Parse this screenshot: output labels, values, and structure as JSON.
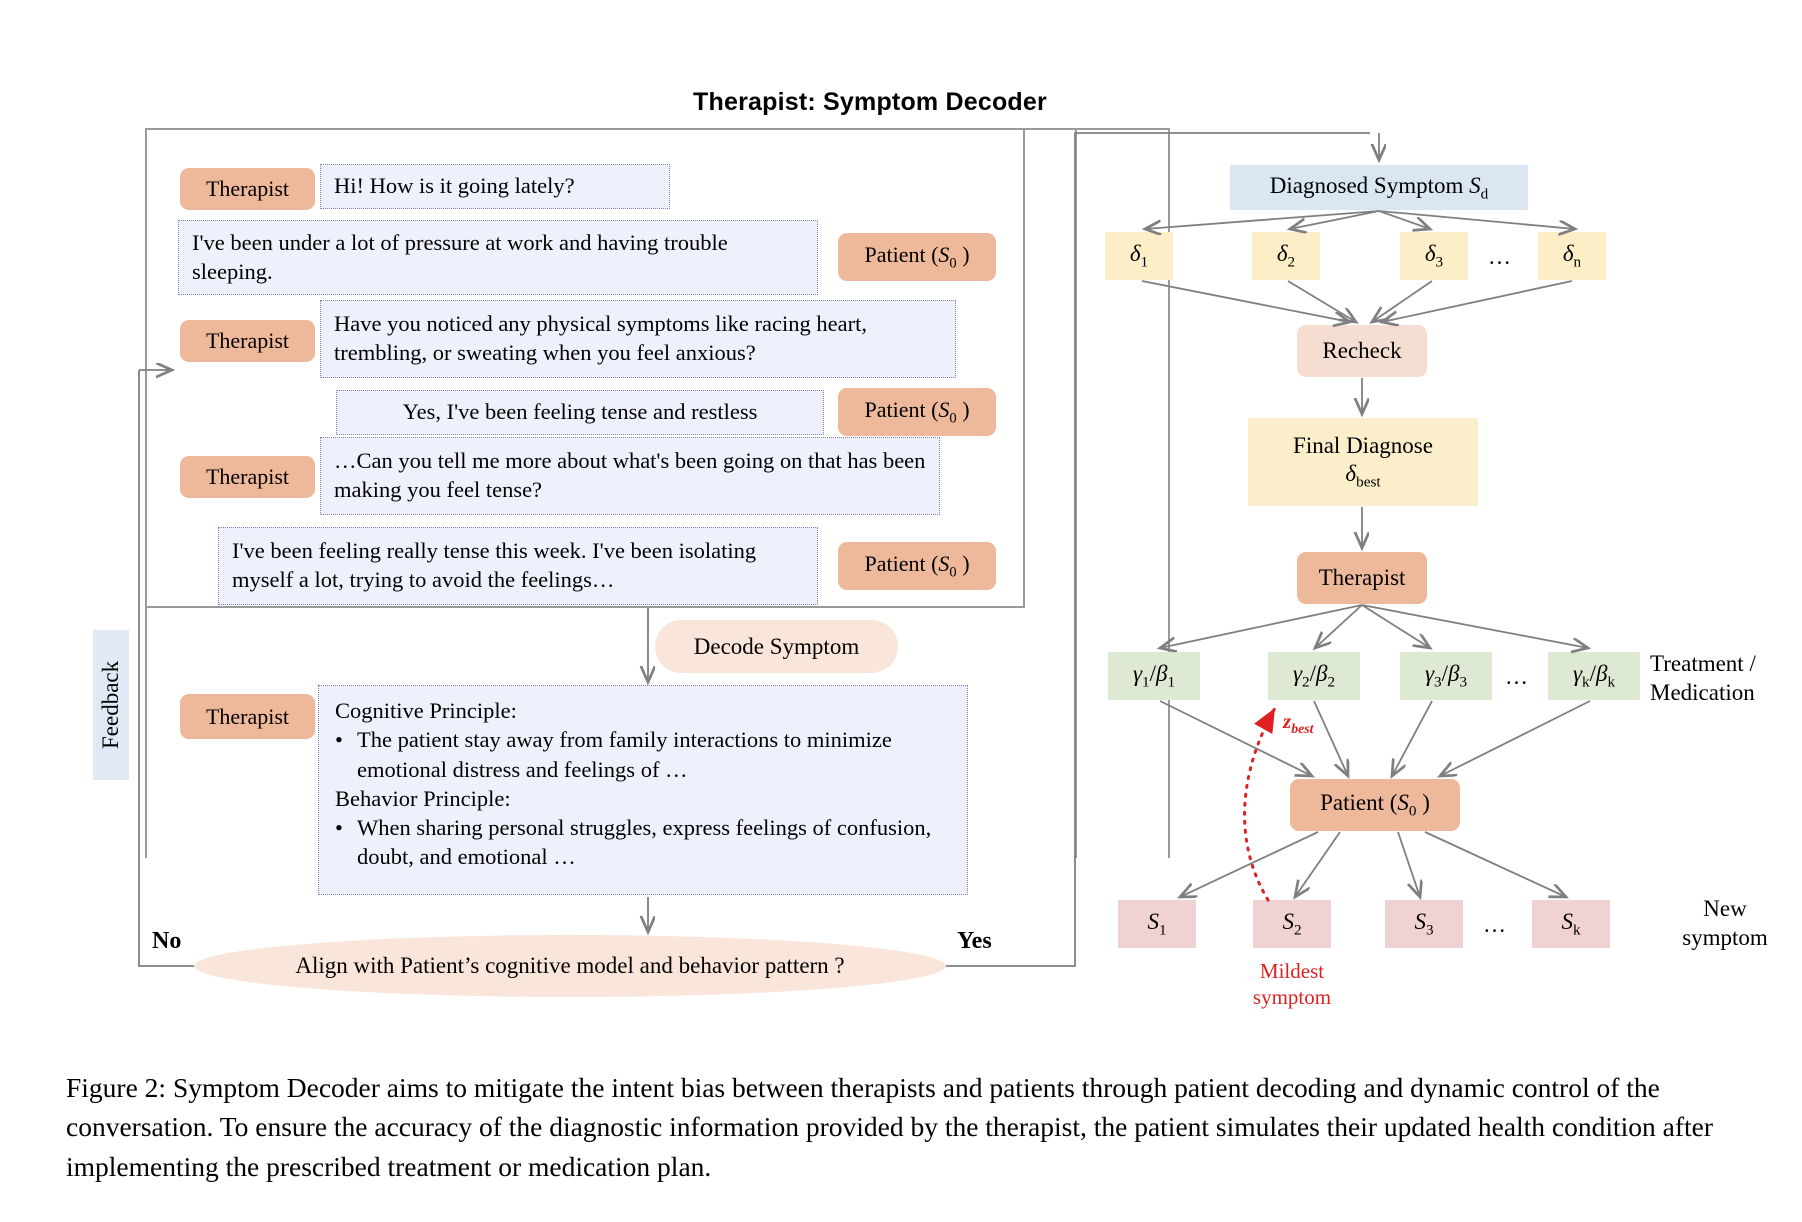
{
  "figure": {
    "title": "Therapist: Symptom Decoder",
    "caption": "Figure 2: Symptom Decoder aims to mitigate the intent bias between therapists and patients through patient decoding and dynamic control of the conversation. To ensure the accuracy of the diagnostic information provided by the therapist, the patient simulates their updated health condition after implementing the prescribed treatment or medication plan."
  },
  "colors": {
    "therapist_chip": "#eeb99b",
    "bubble_bg": "#eef1fb",
    "bubble_border": "#7b86b5",
    "pill_bg": "#fae5da",
    "feedback_bg": "#e1e9f4",
    "node_blue": "#dbe6f3",
    "node_yellow": "#fcefc7",
    "node_peach": "#f5ded1",
    "node_cream": "#fbeecb",
    "node_green": "#dde9d3",
    "node_pink": "#f0d2d2",
    "arrow": "#7f7f7f",
    "accent_red": "#e02020",
    "frame": "#9a9a9a"
  },
  "conversation": {
    "turns": [
      {
        "speaker": "Therapist",
        "side": "left",
        "text": "Hi! How is it going lately?"
      },
      {
        "speaker": "Patient (S0 )",
        "side": "right",
        "text": "I've been under a lot of pressure at work and having trouble sleeping."
      },
      {
        "speaker": "Therapist",
        "side": "left",
        "text": "Have you noticed any physical symptoms like racing heart, trembling, or sweating when you feel anxious?"
      },
      {
        "speaker": "Patient (S0 )",
        "side": "right",
        "text": "Yes, I've been feeling tense and restless"
      },
      {
        "speaker": "Therapist",
        "side": "left",
        "text": "…Can you tell me more about what's been going on that has been making you feel tense?"
      },
      {
        "speaker": "Patient (S0 )",
        "side": "right",
        "text": "I've been feeling really tense this week. I've been isolating myself a lot, trying to avoid the feelings…"
      }
    ]
  },
  "decode": {
    "pill_label": "Decode Symptom",
    "therapist_chip": "Therapist",
    "cognitive_heading": "Cognitive Principle:",
    "cognitive_bullet": "The patient  stay away from family interactions to minimize emotional distress and feelings of …",
    "behavior_heading": "Behavior Principle:",
    "behavior_bullet": "When sharing personal struggles, express feelings of confusion, doubt, and emotional …",
    "bullet_glyph": "•"
  },
  "decision": {
    "question": "Align with Patient’s cognitive model and behavior pattern ?",
    "no_label": "No",
    "yes_label": "Yes",
    "feedback_label": "Feedback"
  },
  "flow": {
    "diagnosed_symptom": "Diagnosed Symptom",
    "diagnosed_symptom_sub": "S",
    "diagnosed_symptom_sub_idx": "d",
    "deltas": [
      "δ",
      "δ",
      "δ",
      "δ"
    ],
    "delta_subs": [
      "1",
      "2",
      "3",
      "n"
    ],
    "ellipsis": "…",
    "recheck": "Recheck",
    "final_diagnose": "Final Diagnose",
    "final_diagnose_symbol": "δ",
    "final_diagnose_sub": "best",
    "therapist": "Therapist",
    "treatments": [
      "γ₁/β₁",
      "γ₂/β₂",
      "γ₃/β₃",
      "γₖ/βₖ"
    ],
    "treatment_caption_line1": "Treatment /",
    "treatment_caption_line2": "Medication",
    "z_best": "z",
    "z_best_sub": "best",
    "patient": "Patient (S0 )",
    "symptoms": [
      "S₁",
      "S₂",
      "S₃",
      "Sₖ"
    ],
    "new_symptom_line1": "New",
    "new_symptom_line2": "symptom",
    "mildest_line1": "Mildest",
    "mildest_line2": "symptom"
  }
}
